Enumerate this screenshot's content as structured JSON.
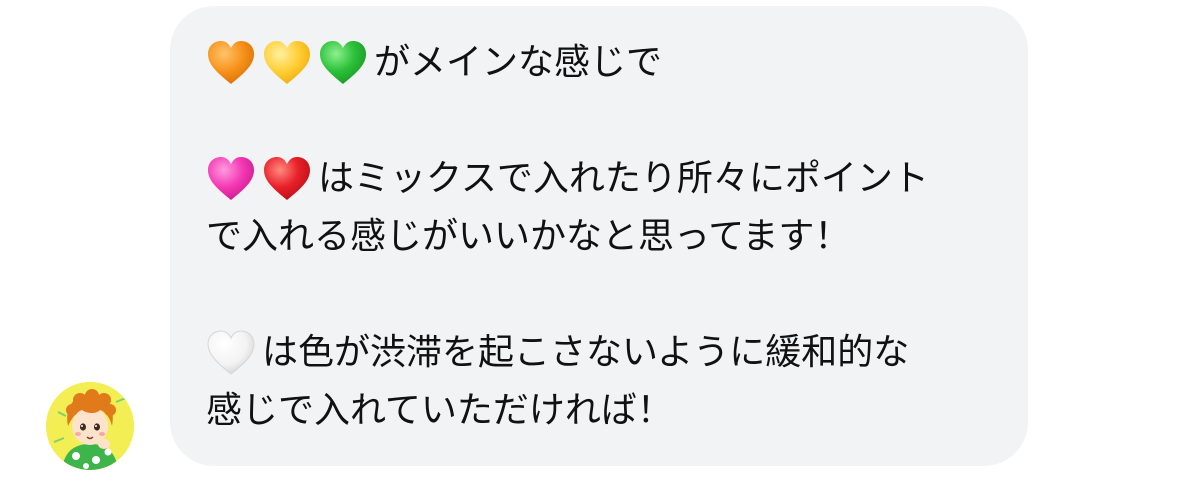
{
  "message": {
    "lines": [
      {
        "hearts": [
          "orange-heart",
          "yellow-heart",
          "green-heart"
        ],
        "text": "がメインな感じで"
      },
      {
        "hearts": [],
        "text": ""
      },
      {
        "hearts": [
          "pink-heart",
          "red-heart"
        ],
        "text": "はミックスで入れたり所々にポイント"
      },
      {
        "hearts": [],
        "text": "で入れる感じがいいかなと思ってます！"
      },
      {
        "hearts": [],
        "text": ""
      },
      {
        "hearts": [
          "white-heart"
        ],
        "text": "は色が渋滞を起こさないように緩和的な"
      },
      {
        "hearts": [],
        "text": "感じで入れていただければ！"
      }
    ]
  },
  "colors": {
    "bubble": "#f2f3f5",
    "text": "#111111",
    "orange-heart": "#f7941d",
    "yellow-heart": "#ffcf3a",
    "green-heart": "#2cc13a",
    "pink-heart": "#f43ab4",
    "red-heart": "#e8202a",
    "white-heart": "#f5f5f5"
  },
  "avatar": {
    "icon": "user-avatar-illustration"
  }
}
